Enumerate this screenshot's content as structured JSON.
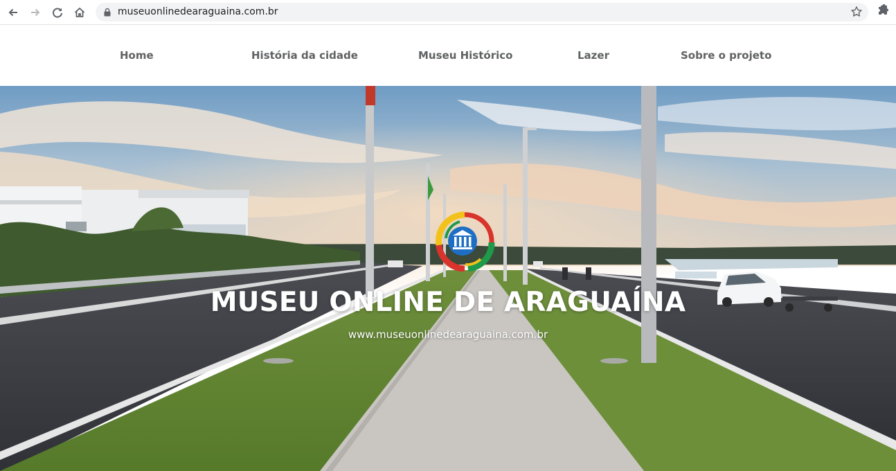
{
  "browser": {
    "url": "museuonlinedearaguaina.com.br",
    "icons": [
      "back-arrow-icon",
      "forward-arrow-icon",
      "reload-icon",
      "home-icon",
      "lock-icon",
      "bookmark-star-icon",
      "extensions-puzzle-icon"
    ]
  },
  "nav": {
    "items": [
      {
        "label": "Home"
      },
      {
        "label": "História da cidade"
      },
      {
        "label": "Museu Histórico"
      },
      {
        "label": "Lazer"
      },
      {
        "label": "Sobre o projeto"
      }
    ]
  },
  "hero": {
    "title": "MUSEU ONLINE DE ARAGUAÍNA",
    "subtitle": "www.museuonlinedearaguaina.com.br"
  },
  "colors": {
    "nav_text": "#5f6163",
    "hero_text": "#ffffff",
    "logo_blue": "#1e6fc4",
    "logo_green": "#1e9a4a",
    "logo_red": "#d8342b",
    "logo_yellow": "#f2c21b"
  }
}
